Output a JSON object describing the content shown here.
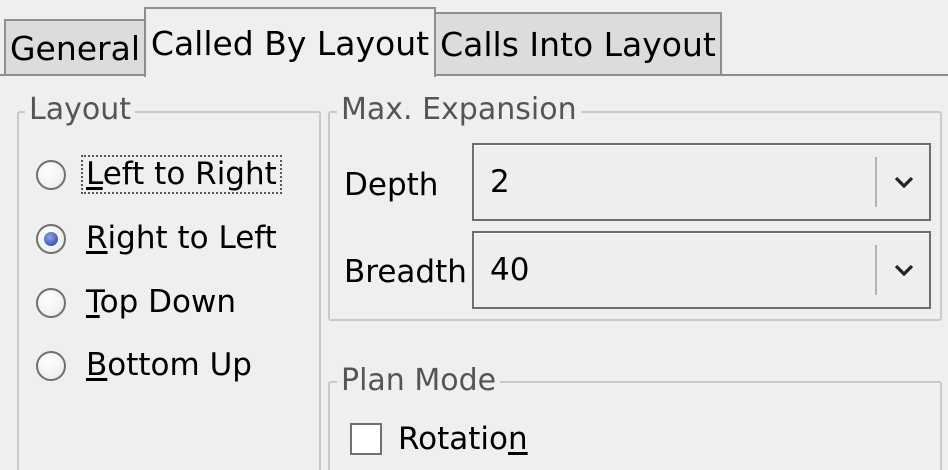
{
  "tabs": [
    {
      "label": "General",
      "active": false
    },
    {
      "label": "Called By Layout",
      "active": true
    },
    {
      "label": "Calls Into Layout",
      "active": false
    }
  ],
  "layout_group": {
    "title": "Layout",
    "options": [
      {
        "label": "Left to Right",
        "mnemonic": "L",
        "rest": "eft to Right",
        "checked": false,
        "focused": true
      },
      {
        "label": "Right to Left",
        "mnemonic": "R",
        "rest": "ight to Left",
        "checked": true,
        "focused": false
      },
      {
        "label": "Top Down",
        "mnemonic": "T",
        "rest": "op Down",
        "checked": false,
        "focused": false
      },
      {
        "label": "Bottom Up",
        "mnemonic": "B",
        "rest": "ottom Up",
        "checked": false,
        "focused": false
      }
    ]
  },
  "expansion_group": {
    "title": "Max. Expansion",
    "depth_label": "Depth",
    "depth_value": "2",
    "breadth_label": "Breadth",
    "breadth_value": "40"
  },
  "plan_group": {
    "title": "Plan Mode",
    "rotation_prefix": "Rotatio",
    "rotation_mnemonic": "n",
    "rotation_checked": false
  },
  "colors": {
    "accent": "#3d5ab8",
    "background": "#efefef",
    "tab_inactive": "#dcdcdc"
  }
}
